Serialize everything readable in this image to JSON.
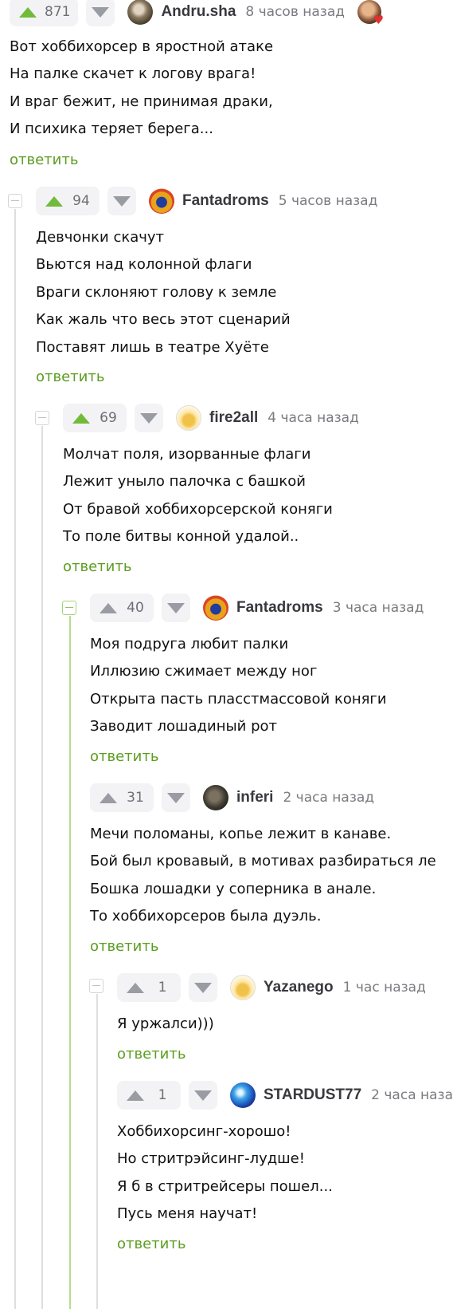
{
  "comments": [
    {
      "author": "Andru.sha",
      "time": "8 часов назад",
      "rating": "871",
      "lines": [
        "Вот хоббихорсер в яростной атаке",
        "На палке скачет к логову врага!",
        "И враг бежит, не принимая драки,",
        "И психика теряет берега..."
      ],
      "reply": "ответить"
    },
    {
      "author": "Fantadroms",
      "time": "5 часов назад",
      "rating": "94",
      "lines": [
        "Девчонки скачут",
        "Вьются над колонной флаги",
        "Враги склоняют голову к земле",
        "Как жаль что весь этот сценарий",
        "Поставят лишь в театре Хуёте"
      ],
      "reply": "ответить"
    },
    {
      "author": "fire2all",
      "time": "4 часа назад",
      "rating": "69",
      "lines": [
        "Молчат поля, изорванные флаги",
        "Лежит уныло палочка с башкой",
        "От бравой хоббихорсерской коняги",
        "То поле битвы конной удалой.."
      ],
      "reply": "ответить"
    },
    {
      "author": "Fantadroms",
      "time": "3 часа назад",
      "rating": "40",
      "lines": [
        "Моя подруга любит палки",
        "Иллюзию сжимает между ног",
        "Открыта пасть пласстмассовой коняги",
        "Заводит лошадиный рот"
      ],
      "reply": "ответить"
    },
    {
      "author": "inferi",
      "time": "2 часа назад",
      "rating": "31",
      "lines": [
        "Мечи поломаны, копье лежит в канаве.",
        "Бой был кровавый, в мотивах разбираться ле",
        "Бошка лошадки у соперника в анале.",
        "То хоббихорсеров была дуэль."
      ],
      "reply": "ответить"
    },
    {
      "author": "Yazanego",
      "time": "1 час назад",
      "rating": "1",
      "lines": [
        "Я уржалси)))"
      ],
      "reply": "ответить"
    },
    {
      "author": "STARDUST77",
      "time": "2 часа наза",
      "rating": "1",
      "lines": [
        "Хоббихорсинг-хорошо!",
        "Но стритрэйсинг-лудше!",
        "Я б в стритрейсеры пошел...",
        "Пусь меня научат!"
      ],
      "reply": "ответить"
    }
  ],
  "colors": {
    "accent_green": "#5b9d20",
    "upvote_green": "#72bb3a",
    "vote_grey": "#9a9ca3",
    "thread_line": "#dedee2",
    "thread_line_green": "#b8dc92"
  },
  "icons": {
    "upvote": "triangle-up-icon",
    "downvote": "triangle-down-icon",
    "collapse": "minus-square-icon",
    "heart": "heart-icon"
  }
}
